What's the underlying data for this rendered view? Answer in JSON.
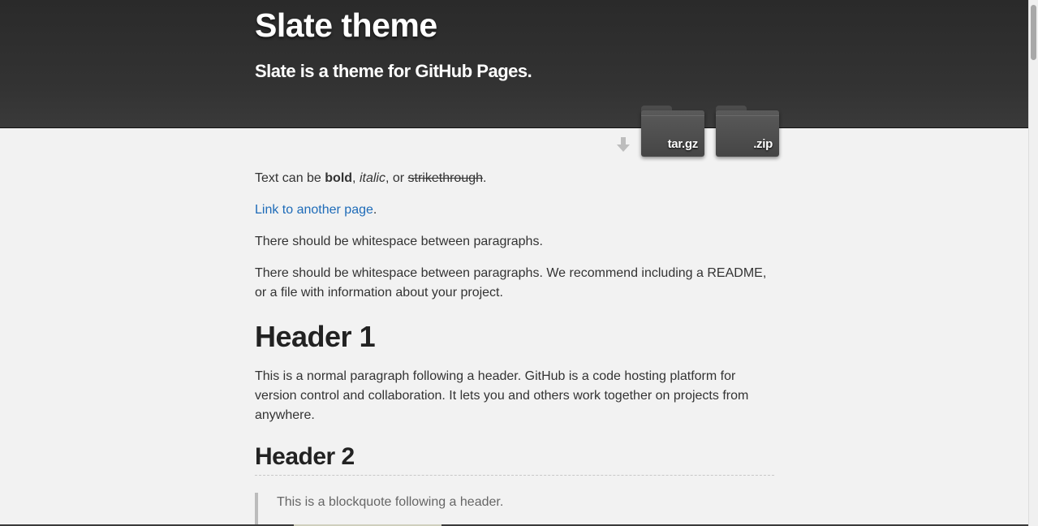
{
  "header": {
    "title": "Slate theme",
    "tagline": "Slate is a theme for GitHub Pages."
  },
  "downloads": {
    "tar_label": "tar.gz",
    "zip_label": ".zip",
    "icon": "download-arrow-icon"
  },
  "content": {
    "p1": {
      "prefix": "Text can be ",
      "bold": "bold",
      "sep1": ", ",
      "italic": "italic",
      "sep2": ", or ",
      "strike": "strikethrough",
      "suffix": "."
    },
    "p2": {
      "link": "Link to another page",
      "suffix": "."
    },
    "p3": "There should be whitespace between paragraphs.",
    "p4": "There should be whitespace between paragraphs. We recommend including a README, or a file with information about your project.",
    "h1": "Header 1",
    "p5": "This is a normal paragraph following a header. GitHub is a code hosting platform for version control and collaboration. It lets you and others work together on projects from anywhere.",
    "h2": "Header 2",
    "blockquote": "This is a blockquote following a header."
  },
  "colors": {
    "header_bg": "#2e2e2e",
    "page_bg": "#f2f2f2",
    "link": "#1e6bb8",
    "text": "#333333"
  }
}
